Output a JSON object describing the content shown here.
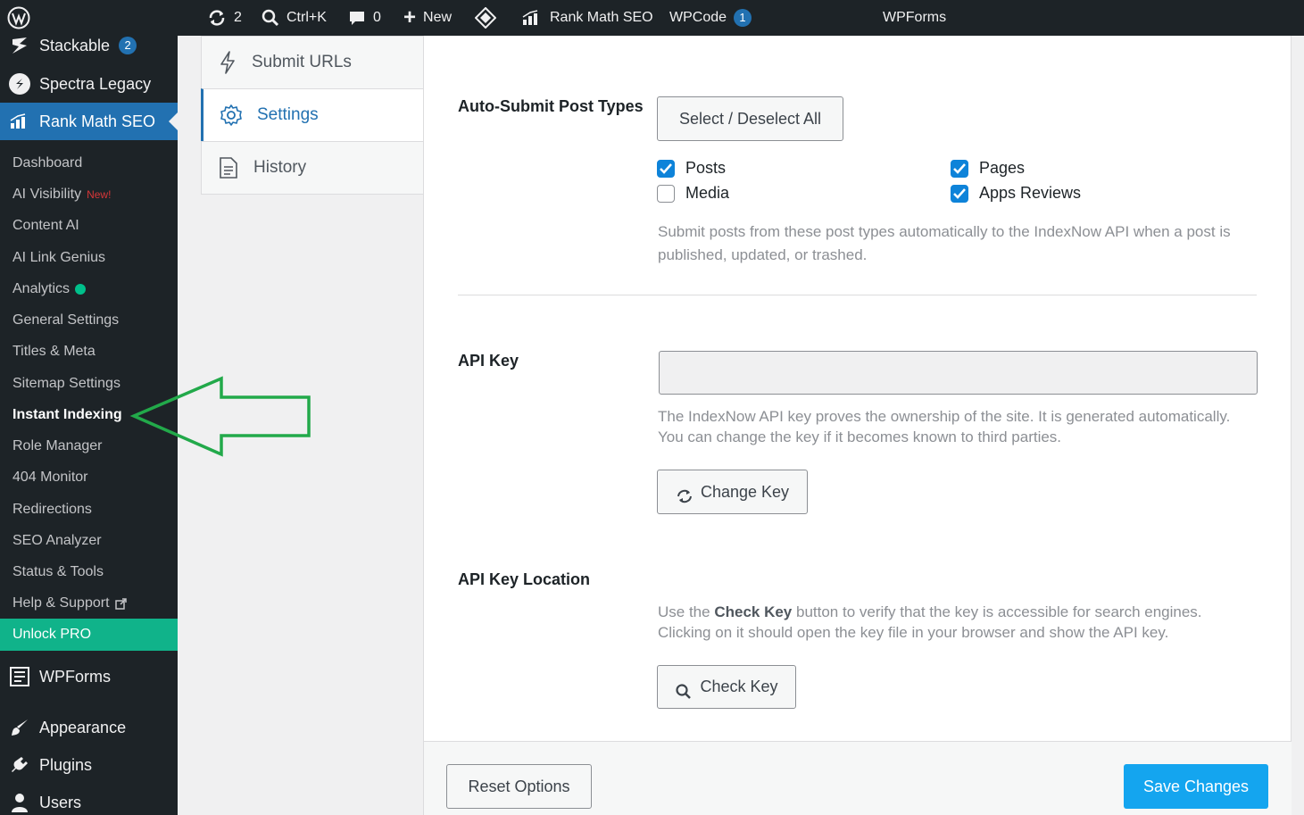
{
  "adminbar": {
    "updates_count": "2",
    "search_shortcut": "Ctrl+K",
    "comments_count": "0",
    "new_label": "New",
    "rankmath_label": "Rank Math SEO",
    "wpcode_label": "WPCode",
    "wpcode_badge": "1",
    "wpforms_label": "WPForms"
  },
  "sidebar": {
    "top_items": [
      {
        "label": "Stackable",
        "badge": "2",
        "icon": "stackable-icon"
      },
      {
        "label": "Spectra Legacy",
        "icon": "spectra-icon"
      },
      {
        "label": "Rank Math SEO",
        "icon": "rank-math-icon"
      }
    ],
    "submenu": [
      {
        "label": "Dashboard"
      },
      {
        "label": "AI Visibility",
        "tag": "New!"
      },
      {
        "label": "Content AI"
      },
      {
        "label": "AI Link Genius"
      },
      {
        "label": "Analytics"
      },
      {
        "label": "General Settings"
      },
      {
        "label": "Titles & Meta"
      },
      {
        "label": "Sitemap Settings"
      },
      {
        "label": "Instant Indexing"
      },
      {
        "label": "Role Manager"
      },
      {
        "label": "404 Monitor"
      },
      {
        "label": "Redirections"
      },
      {
        "label": "SEO Analyzer"
      },
      {
        "label": "Status & Tools"
      },
      {
        "label": "Help & Support"
      }
    ],
    "unlock_label": "Unlock PRO",
    "bottom_items": [
      {
        "label": "WPForms",
        "icon": "wpforms-icon"
      },
      {
        "label": "Appearance",
        "icon": "paintbrush-icon"
      },
      {
        "label": "Plugins",
        "icon": "plug-icon"
      },
      {
        "label": "Users",
        "icon": "user-icon"
      }
    ]
  },
  "tabs": [
    {
      "label": "Submit URLs",
      "icon": "lightning-icon"
    },
    {
      "label": "Settings",
      "icon": "gear-icon"
    },
    {
      "label": "History",
      "icon": "document-icon"
    }
  ],
  "settings": {
    "auto_submit_label": "Auto-Submit Post Types",
    "select_all_label": "Select / Deselect All",
    "post_types": [
      {
        "label": "Posts",
        "checked": true
      },
      {
        "label": "Pages",
        "checked": true
      },
      {
        "label": "Media",
        "checked": false
      },
      {
        "label": "Apps Reviews",
        "checked": true
      }
    ],
    "auto_submit_desc": "Submit posts from these post types automatically to the IndexNow API when a post is published, updated, or trashed.",
    "api_key_label": "API Key",
    "api_key_value": "",
    "api_key_desc": "The IndexNow API key proves the ownership of the site. It is generated automatically. You can change the key if it becomes known to third parties.",
    "change_key_label": "Change Key",
    "api_location_label": "API Key Location",
    "api_location_desc_pre": "Use the",
    "api_location_desc_bold": "Check Key",
    "api_location_desc_post": "button to verify that the key is accessible for search engines. Clicking on it should open the key file in your browser and show the API key.",
    "check_key_label": "Check Key"
  },
  "footer": {
    "reset_label": "Reset Options",
    "save_label": "Save Changes"
  },
  "colors": {
    "admin_dark": "#1d2327",
    "wp_blue": "#2271b1",
    "unlock_green": "#10b38a",
    "save_blue": "#14a5ef",
    "annotation_arrow": "#22a94a"
  }
}
